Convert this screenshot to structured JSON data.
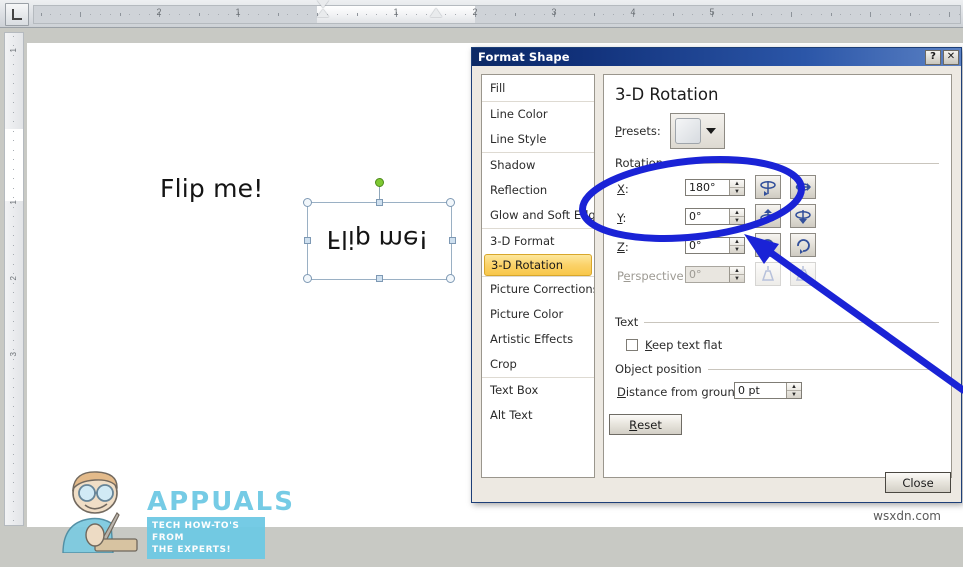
{
  "document": {
    "plain_text": "Flip me!",
    "shape_text": "Flip me!",
    "shape_transform": "vertically-flipped"
  },
  "ruler": {
    "horizontal_numbers": [
      "2",
      "1",
      "1",
      "2",
      "3",
      "4",
      "5"
    ],
    "vertical_numbers": [
      "1",
      "1",
      "2",
      "3"
    ],
    "corner_tab_icon": "left-tab-stop-icon"
  },
  "watermark": {
    "brand": "APPUALS",
    "tagline_line1": "TECH HOW-TO'S FROM",
    "tagline_line2": "THE EXPERTS!",
    "site": "wsxdn.com",
    "brand_color": "#6ec9e4"
  },
  "dialog": {
    "title": "Format Shape",
    "help_button": "?",
    "close_button": "✕",
    "sidebar": {
      "items": [
        {
          "label": "Fill",
          "selected": false,
          "group_start": false
        },
        {
          "label": "Line Color",
          "selected": false,
          "group_start": true
        },
        {
          "label": "Line Style",
          "selected": false,
          "group_start": false
        },
        {
          "label": "Shadow",
          "selected": false,
          "group_start": true
        },
        {
          "label": "Reflection",
          "selected": false,
          "group_start": false
        },
        {
          "label": "Glow and Soft Edges",
          "selected": false,
          "group_start": false
        },
        {
          "label": "3-D Format",
          "selected": false,
          "group_start": true
        },
        {
          "label": "3-D Rotation",
          "selected": true,
          "group_start": false
        },
        {
          "label": "Picture Corrections",
          "selected": false,
          "group_start": true
        },
        {
          "label": "Picture Color",
          "selected": false,
          "group_start": false
        },
        {
          "label": "Artistic Effects",
          "selected": false,
          "group_start": false
        },
        {
          "label": "Crop",
          "selected": false,
          "group_start": false
        },
        {
          "label": "Text Box",
          "selected": false,
          "group_start": true
        },
        {
          "label": "Alt Text",
          "selected": false,
          "group_start": false
        }
      ]
    },
    "panel": {
      "heading": "3-D Rotation",
      "presets": {
        "label": "Presets:",
        "selected_value": "",
        "caret_icon": "chevron-down-icon"
      },
      "rotation_group": "Rotation",
      "fields": [
        {
          "label": "X:",
          "value": "180°",
          "disabled": false,
          "left_icon": "rotate-x-left-icon",
          "right_icon": "rotate-x-right-icon"
        },
        {
          "label": "Y:",
          "value": "0°",
          "disabled": false,
          "left_icon": "rotate-y-up-icon",
          "right_icon": "rotate-y-down-icon"
        },
        {
          "label": "Z:",
          "value": "0°",
          "disabled": false,
          "left_icon": "rotate-z-ccw-icon",
          "right_icon": "rotate-z-cw-icon"
        },
        {
          "label": "Perspective:",
          "value": "0°",
          "disabled": true,
          "left_icon": "perspective-narrow-icon",
          "right_icon": "perspective-widen-icon"
        }
      ],
      "text_group": "Text",
      "keep_text_flat": {
        "label": "Keep text flat",
        "checked": false
      },
      "object_position_group": "Object position",
      "distance_from_ground": {
        "label": "Distance from ground:",
        "value": "0 pt"
      },
      "reset_button": "Reset"
    },
    "close_label": "Close"
  },
  "annotations": {
    "ellipse_color": "#1a23d6",
    "arrow_color": "#1a23d6",
    "ellipse_target": "x-and-y-rotation-fields",
    "arrow_target": "z-rotation-spinner"
  }
}
